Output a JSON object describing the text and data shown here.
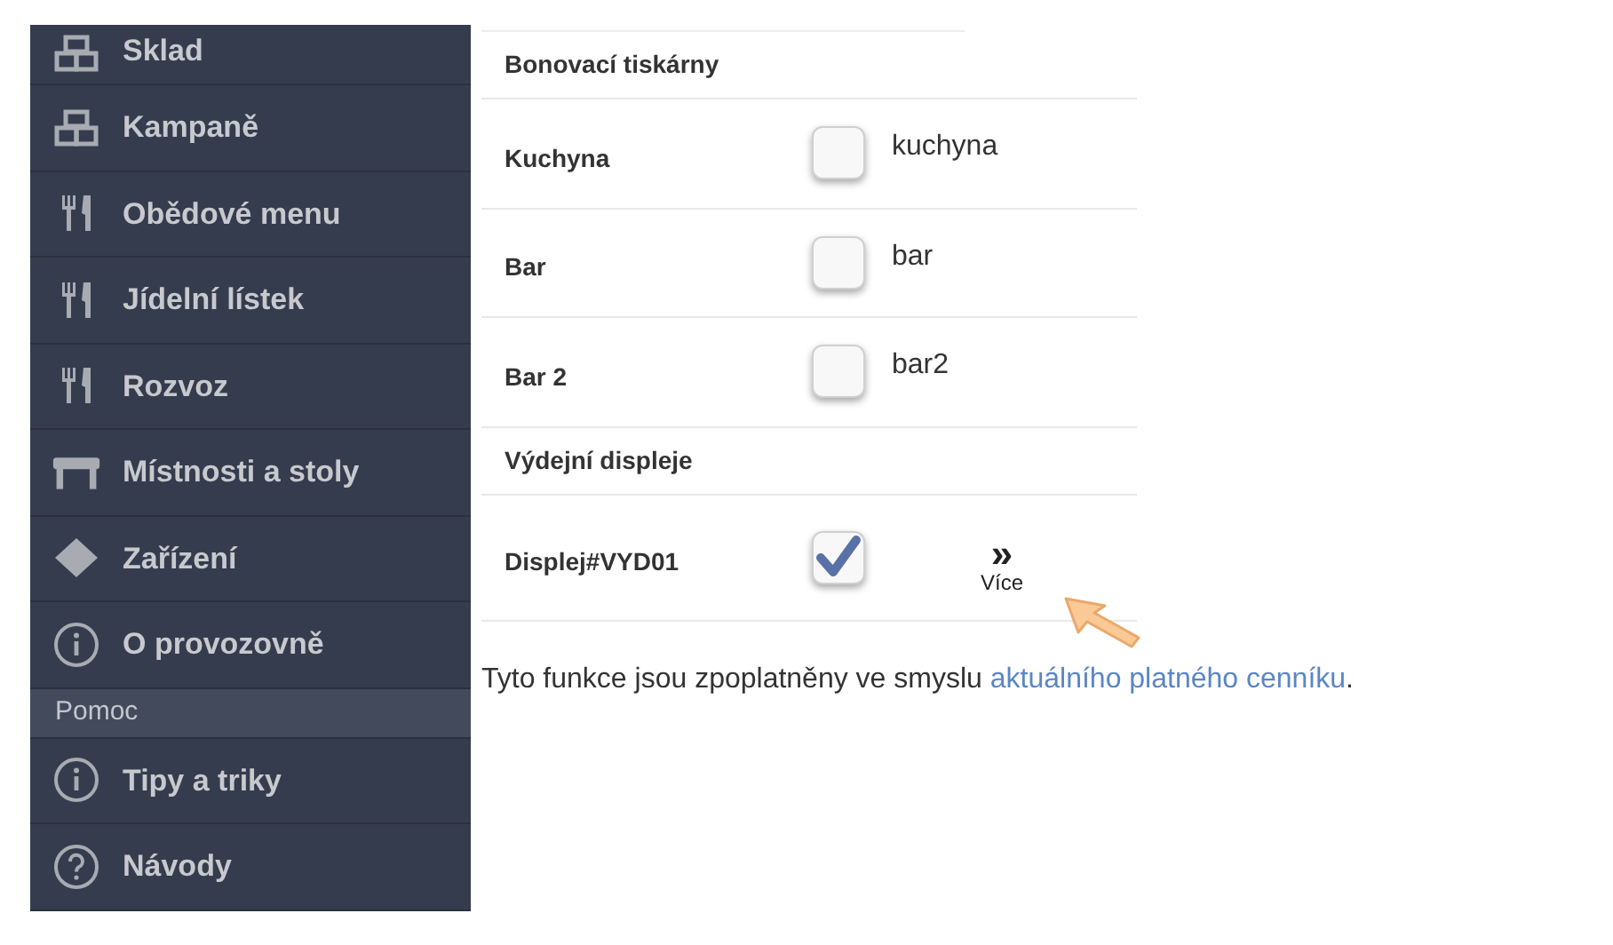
{
  "sidebar": {
    "items": [
      {
        "label": "Sklad",
        "kind": "boxes"
      },
      {
        "label": "Kampaně",
        "kind": "boxes"
      },
      {
        "label": "Obědové menu",
        "kind": "cutlery"
      },
      {
        "label": "Jídelní lístek",
        "kind": "cutlery"
      },
      {
        "label": "Rozvoz",
        "kind": "cutlery"
      },
      {
        "label": "Místnosti a stoly",
        "kind": "table"
      },
      {
        "label": "Zařízení",
        "kind": "diamond"
      },
      {
        "label": "O provozovně",
        "kind": "info"
      },
      {
        "label": "Pomoc",
        "kind": "header"
      },
      {
        "label": "Tipy a triky",
        "kind": "info"
      },
      {
        "label": "Návody",
        "kind": "help"
      }
    ]
  },
  "sections": [
    {
      "title": "Bonovací tiskárny",
      "rows": [
        {
          "name": "Kuchyna",
          "checked": false,
          "value": "kuchyna"
        },
        {
          "name": "Bar",
          "checked": false,
          "value": "bar"
        },
        {
          "name": "Bar 2",
          "checked": false,
          "value": "bar2"
        }
      ]
    },
    {
      "title": "Výdejní displeje",
      "rows": [
        {
          "name": "Displej#VYD01",
          "checked": true,
          "more": {
            "icon": "»",
            "label": "Více"
          }
        }
      ]
    }
  ],
  "note": {
    "text": "Tyto funkce jsou zpoplatněny ve smyslu ",
    "link": "aktuálního platného cenníku",
    "end": "."
  }
}
